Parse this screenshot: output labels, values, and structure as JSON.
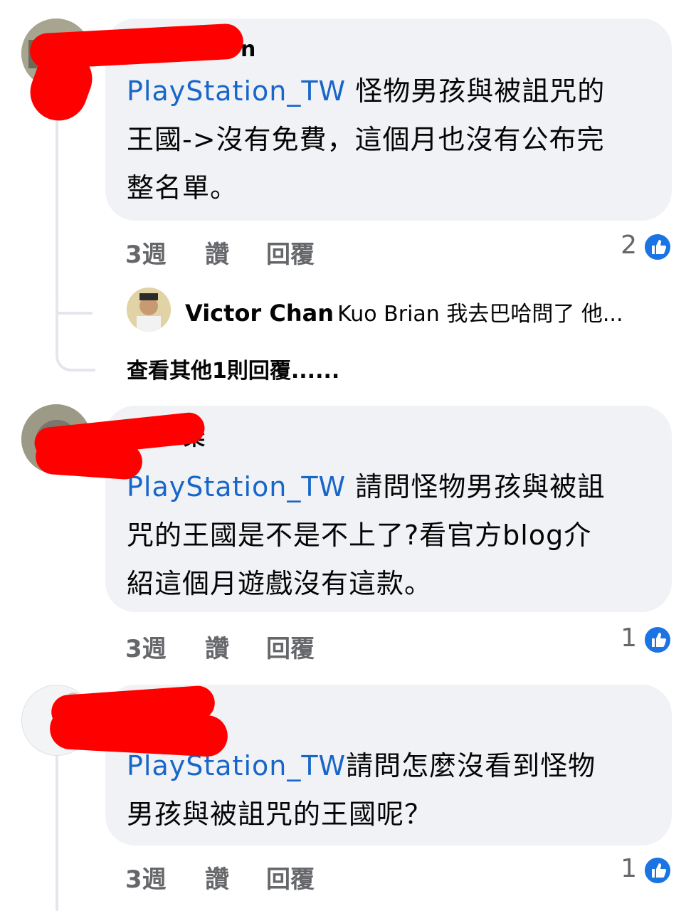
{
  "comments": [
    {
      "author_visible_fragment": "n",
      "mention": "PlayStation_TW",
      "text": " 怪物男孩與被詛咒的王國->沒有免費，這個月也沒有公布完整名單。",
      "lines": [
        "怪物男孩與被詛咒的",
        "王國->沒有免費，這個月也沒有公布完",
        "整名單。"
      ],
      "time": "3週",
      "like_label": "讚",
      "reply_label": "回覆",
      "reaction_count": "2"
    },
    {
      "author_visible_fragment": "梁",
      "mention": "PlayStation_TW",
      "lines": [
        " 請問怪物男孩與被詛",
        "咒的王國是不是不上了?看官方blog介",
        "紹這個月遊戲沒有這款。"
      ],
      "time": "3週",
      "like_label": "讚",
      "reply_label": "回覆",
      "reaction_count": "1"
    },
    {
      "author_visible_fragment": "",
      "mention": "PlayStation_TW",
      "lines": [
        "請問怎麼沒看到怪物",
        "男孩與被詛咒的王國呢？"
      ],
      "time": "3週",
      "like_label": "讚",
      "reply_label": "回覆",
      "reaction_count": "1"
    }
  ],
  "reply_preview": {
    "name": "Victor Chan",
    "text": "Kuo Brian 我去巴哈問了 他..."
  },
  "more_replies_label": "查看其他1則回覆......",
  "icons": {
    "like": "thumbs-up-icon"
  },
  "colors": {
    "mention": "#1866c9",
    "like_badge": "#1b74e4",
    "bubble": "#f0f2f5",
    "redaction": "#ff0000"
  }
}
